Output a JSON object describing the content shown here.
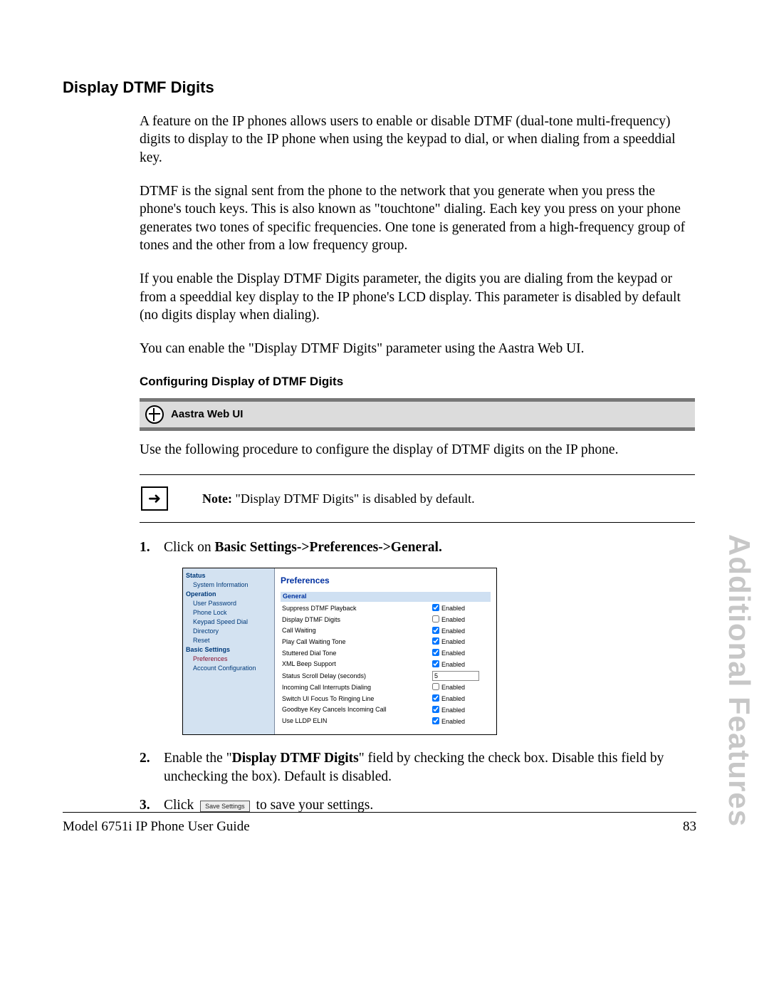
{
  "section_title": "Display DTMF Digits",
  "paragraphs": {
    "p1": "A feature on the IP phones allows users to enable or disable DTMF (dual-tone multi-frequency) digits to display to the IP phone when using the keypad to dial, or when dialing from a speeddial key.",
    "p2": "DTMF is the signal sent from the phone to the network that you generate when you press the phone's touch keys. This is also known as \"touchtone\" dialing. Each key you press on your phone generates two tones of specific frequencies. One tone is generated from a high-frequency group of tones and the other from a low frequency group.",
    "p3": "If you enable the Display DTMF Digits parameter, the digits you are dialing from the keypad or from a speeddial key display to the IP phone's LCD display. This parameter is disabled by default (no digits display when dialing).",
    "p4": "You can enable the \"Display DTMF Digits\" parameter using the Aastra Web UI."
  },
  "sub_title": "Configuring Display of DTMF Digits",
  "ui_banner": "Aastra Web UI",
  "use_line": "Use the following procedure to configure the display of DTMF digits on the IP phone.",
  "note_label": "Note:",
  "note_text": " \"Display DTMF Digits\" is disabled by default.",
  "steps": {
    "s1_pre": "Click on ",
    "s1_bold": "Basic Settings->Preferences->General.",
    "s2_pre": "Enable the \"",
    "s2_bold": "Display DTMF Digits",
    "s2_post": "\" field by checking the check box. Disable this field by unchecking the box). Default is disabled.",
    "s3_pre": "Click ",
    "s3_btn": "Save Settings",
    "s3_post": " to save your settings."
  },
  "webui": {
    "side": {
      "h1": "Status",
      "i1": "System Information",
      "h2": "Operation",
      "i2": "User Password",
      "i3": "Phone Lock",
      "i4": "Keypad Speed Dial",
      "i5": "Directory",
      "i6": "Reset",
      "h3": "Basic Settings",
      "i7": "Preferences",
      "i8": "Account Configuration"
    },
    "title": "Preferences",
    "section": "General",
    "rows": [
      {
        "label": "Suppress DTMF Playback",
        "ctl": "check",
        "checked": true
      },
      {
        "label": "Display DTMF Digits",
        "ctl": "check",
        "checked": false
      },
      {
        "label": "Call Waiting",
        "ctl": "check",
        "checked": true
      },
      {
        "label": "Play Call Waiting Tone",
        "ctl": "check",
        "checked": true
      },
      {
        "label": "Stuttered Dial Tone",
        "ctl": "check",
        "checked": true
      },
      {
        "label": "XML Beep Support",
        "ctl": "check",
        "checked": true
      },
      {
        "label": "Status Scroll Delay (seconds)",
        "ctl": "text",
        "value": "5"
      },
      {
        "label": "Incoming Call Interrupts Dialing",
        "ctl": "check",
        "checked": false
      },
      {
        "label": "Switch UI Focus To Ringing Line",
        "ctl": "check",
        "checked": true
      },
      {
        "label": "Goodbye Key Cancels Incoming Call",
        "ctl": "check",
        "checked": true
      },
      {
        "label": "Use LLDP ELIN",
        "ctl": "check",
        "checked": true
      }
    ],
    "enabled_label": "Enabled"
  },
  "side_tab": "Additional Features",
  "footer_left": "Model 6751i IP Phone User Guide",
  "footer_right": "83"
}
